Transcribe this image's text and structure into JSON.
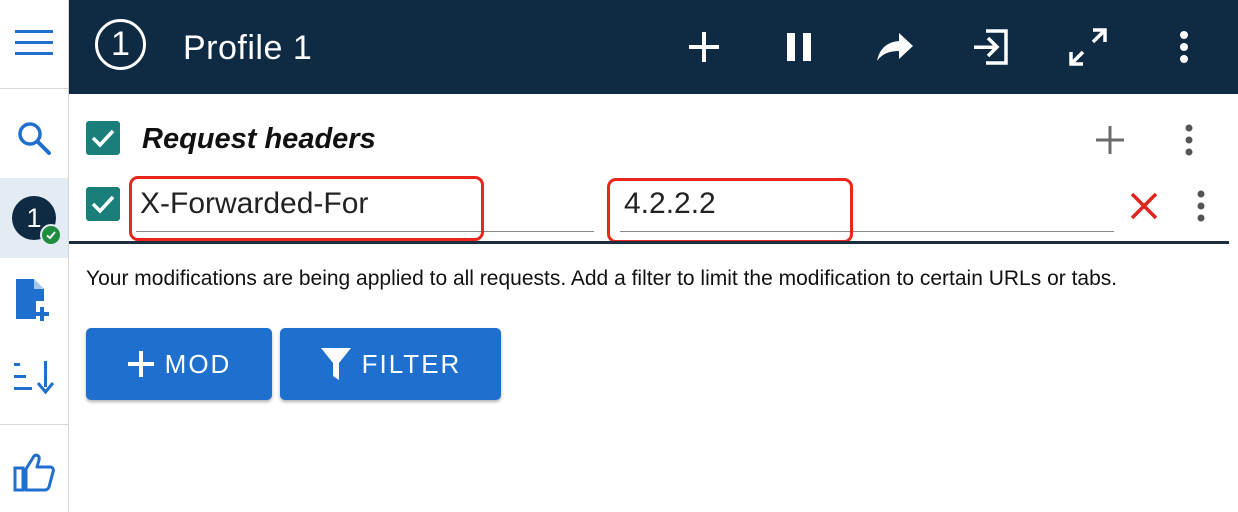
{
  "app": {
    "profile_number": "1",
    "profile_name": "Profile 1"
  },
  "sidebar": {
    "items": [
      {
        "icon": "menu-icon"
      },
      {
        "icon": "search-icon"
      },
      {
        "icon": "profile-avatar",
        "label": "1"
      },
      {
        "icon": "add-file-icon"
      },
      {
        "icon": "sort-icon"
      },
      {
        "icon": "thumbs-up-icon"
      }
    ],
    "active_profile": "1"
  },
  "header": {
    "badge": "1",
    "title": "Profile 1",
    "actions": [
      "add-icon",
      "pause-icon",
      "share-icon",
      "import-icon",
      "fullscreen-icon",
      "more-vert-icon"
    ]
  },
  "section": {
    "title": "Request headers",
    "enabled": true
  },
  "headers": [
    {
      "enabled": true,
      "name": "X-Forwarded-For",
      "value": "4.2.2.2"
    }
  ],
  "info_text": "Your modifications are being applied to all requests. Add a filter to limit the modification to certain URLs or tabs.",
  "buttons": {
    "mod": "MOD",
    "filter": "FILTER"
  },
  "colors": {
    "header_bg": "#0f2a43",
    "accent_blue": "#1f6fcf",
    "check_teal": "#1a7f7a",
    "delete_red": "#e0251b",
    "highlight_red": "#e8261c",
    "active_bg": "#e3ebf3"
  }
}
